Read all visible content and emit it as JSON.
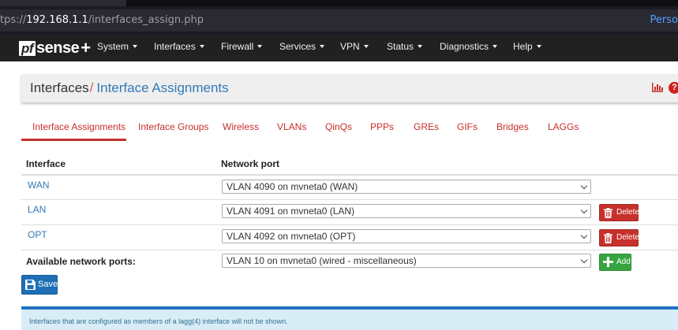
{
  "browser": {
    "url_prefix": "tps://",
    "url_host": "192.168.1.1",
    "url_path": "/interfaces_assign.php",
    "right_text": "Perso"
  },
  "navbar": {
    "logo_pf": "pf",
    "logo_sense": "sense",
    "logo_plus": "+",
    "items": [
      {
        "label": "System"
      },
      {
        "label": "Interfaces"
      },
      {
        "label": "Firewall"
      },
      {
        "label": "Services"
      },
      {
        "label": "VPN"
      },
      {
        "label": "Status"
      },
      {
        "label": "Diagnostics"
      },
      {
        "label": "Help"
      }
    ]
  },
  "breadcrumb": {
    "parent": "Interfaces",
    "separator": "/",
    "current": "Interface Assignments",
    "help_glyph": "?"
  },
  "tabs": [
    {
      "label": "Interface Assignments",
      "active": true
    },
    {
      "label": "Interface Groups"
    },
    {
      "label": "Wireless"
    },
    {
      "label": "VLANs"
    },
    {
      "label": "QinQs"
    },
    {
      "label": "PPPs"
    },
    {
      "label": "GREs"
    },
    {
      "label": "GIFs"
    },
    {
      "label": "Bridges"
    },
    {
      "label": "LAGGs"
    }
  ],
  "table": {
    "headers": {
      "interface": "Interface",
      "network_port": "Network port"
    },
    "rows": [
      {
        "interface": "WAN",
        "port": "VLAN 4090 on mvneta0 (WAN)",
        "deletable": false
      },
      {
        "interface": "LAN",
        "port": "VLAN 4091 on mvneta0 (LAN)",
        "deletable": true
      },
      {
        "interface": "OPT",
        "port": "VLAN 4092 on mvneta0 (OPT)",
        "deletable": true
      }
    ],
    "available_label": "Available network ports:",
    "available_port": "VLAN 10 on mvneta0 (wired - miscellaneous)"
  },
  "buttons": {
    "delete_label": "Delete",
    "add_label": "Add",
    "save_label": "Save"
  },
  "info": {
    "text": "Interfaces that are configured as members of a lagg(4) interface will not be shown."
  },
  "colors": {
    "brand_red": "#c7302b",
    "link_blue": "#337ab7",
    "save_blue": "#1e6fb5",
    "add_green": "#36a541",
    "navbar_bg": "#212121"
  },
  "icons": {
    "trash": "trash-icon",
    "plus": "plus-icon",
    "save": "save-icon",
    "chart": "bar-chart-icon",
    "help": "help-icon"
  }
}
